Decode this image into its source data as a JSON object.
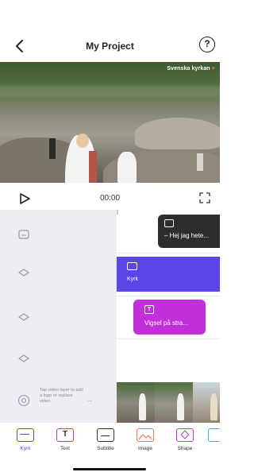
{
  "header": {
    "title": "My Project",
    "help_label": "?"
  },
  "video": {
    "watermark": "Svenska kyrkan",
    "watermark_heart": "♥"
  },
  "player": {
    "time": "00:00"
  },
  "layers": {
    "hint": "Tap video layer to add a logo or replace video.",
    "icons": [
      "subtitle-layer-icon",
      "diamond-layer-icon",
      "diamond-layer-icon",
      "diamond-layer-icon"
    ]
  },
  "timeline": {
    "clips": [
      {
        "label": "– Hej jag hete...",
        "color": "#2d2d2f"
      },
      {
        "label": "Kyrk",
        "color": "#5a45e8"
      },
      {
        "label": "Vigsel på stra...",
        "icon_text": "T",
        "color": "#c12fd9"
      }
    ]
  },
  "toolbar": {
    "items": [
      {
        "label": "Kyrk",
        "icon": "logo-layer-icon",
        "active": true
      },
      {
        "label": "Text",
        "icon": "text-icon",
        "glyph": "T"
      },
      {
        "label": "Subtitle",
        "icon": "subtitle-icon"
      },
      {
        "label": "Image",
        "icon": "image-icon"
      },
      {
        "label": "Shape",
        "icon": "shape-icon"
      }
    ]
  },
  "colors": {
    "accent": "#5a45e8",
    "magenta": "#c12fd9",
    "panel": "#eeebf3"
  }
}
